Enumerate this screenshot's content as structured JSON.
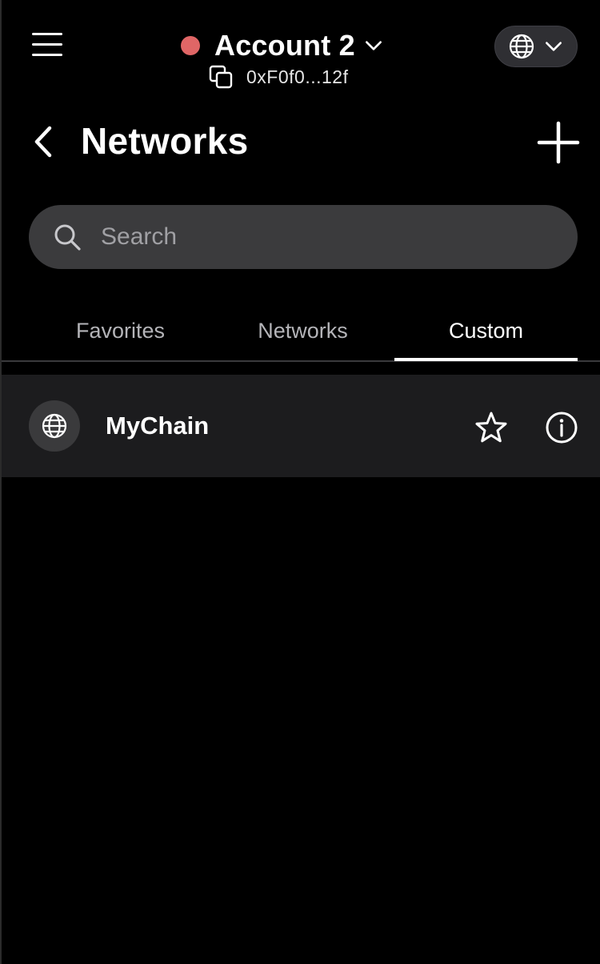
{
  "header": {
    "menu_icon": "hamburger-icon",
    "account_name": "Account 2",
    "account_status_color": "#e06666",
    "account_chevron_icon": "chevron-down-icon",
    "copy_icon": "copy-icon",
    "address": "0xF0f0...12f",
    "network_picker_icon": "globe-icon",
    "network_picker_chevron": "chevron-down-icon"
  },
  "page": {
    "back_icon": "chevron-left-icon",
    "title": "Networks",
    "add_icon": "plus-icon"
  },
  "search": {
    "placeholder": "Search",
    "value": "",
    "icon": "search-icon"
  },
  "tabs": [
    {
      "label": "Favorites",
      "active": false
    },
    {
      "label": "Networks",
      "active": false
    },
    {
      "label": "Custom",
      "active": true
    }
  ],
  "networks": [
    {
      "name": "MyChain",
      "avatar_icon": "globe-icon",
      "favorite_icon": "star-outline-icon",
      "info_icon": "info-icon"
    }
  ],
  "colors": {
    "background": "#000000",
    "row_background": "#1c1c1e",
    "search_background": "#3b3b3d",
    "inactive_tab": "#b4b4b8",
    "accent": "#ffffff"
  }
}
